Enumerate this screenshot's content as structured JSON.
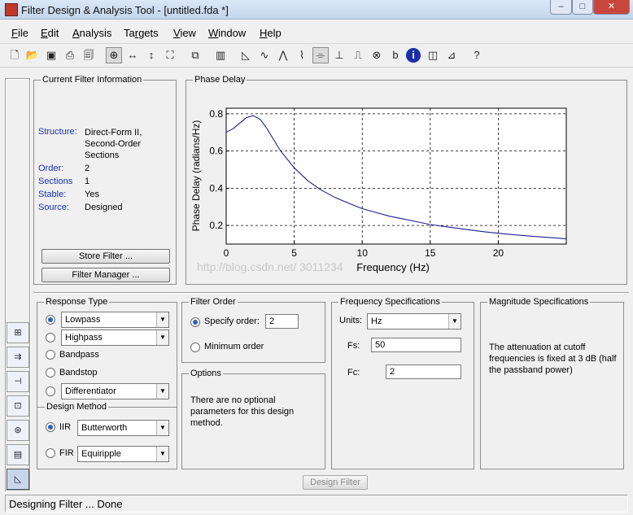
{
  "window": {
    "title": "Filter Design & Analysis Tool - [untitled.fda *]",
    "minimize": "–",
    "maximize": "□",
    "close": "✕"
  },
  "menu": [
    "File",
    "Edit",
    "Analysis",
    "Targets",
    "View",
    "Window",
    "Help"
  ],
  "toolbar_icons": [
    "new-icon",
    "open-icon",
    "save-icon",
    "print-icon",
    "print-preview-icon",
    "zoom-in-icon",
    "zoom-x-icon",
    "zoom-y-icon",
    "full-view-icon",
    "copy-icon",
    "filter-specs-icon",
    "magnitude-response-icon",
    "phase-response-icon",
    "magnitude-phase-icon",
    "group-delay-icon",
    "phase-delay-icon",
    "impulse-response-icon",
    "step-response-icon",
    "pole-zero-icon",
    "filter-coefficients-icon",
    "filter-information-icon",
    "magnitude-estimate-icon",
    "round-off-noise-icon",
    "whats-this-icon"
  ],
  "current_filter": {
    "legend": "Current Filter Information",
    "rows": [
      {
        "key": "Structure:",
        "val": "Direct-Form II, Second-Order Sections"
      },
      {
        "key": "Order:",
        "val": "2"
      },
      {
        "key": "Sections",
        "val": "1"
      },
      {
        "key": "Stable:",
        "val": "Yes"
      },
      {
        "key": "Source:",
        "val": "Designed"
      }
    ],
    "store_button": "Store Filter ...",
    "manager_button": "Filter Manager ..."
  },
  "plot": {
    "legend": "Phase Delay",
    "watermark": "http://blog.csdn.net/   3011234"
  },
  "chart_data": {
    "type": "line",
    "title": "",
    "xlabel": "Frequency (Hz)",
    "ylabel": "Phase Delay (radians/Hz)",
    "xlim": [
      0,
      25
    ],
    "ylim": [
      0.1,
      0.83
    ],
    "xticks": [
      0,
      5,
      10,
      15,
      20
    ],
    "yticks": [
      0.2,
      0.4,
      0.6,
      0.8
    ],
    "grid": true,
    "series": [
      {
        "color": "#1f1f8f",
        "x": [
          0,
          0.5,
          1,
          1.5,
          2,
          2.5,
          3,
          3.5,
          4,
          5,
          6,
          7,
          8,
          9,
          10,
          11,
          12,
          13,
          14,
          15,
          16,
          17,
          18,
          19,
          20,
          21,
          22,
          23,
          24,
          25
        ],
        "y": [
          0.7,
          0.72,
          0.75,
          0.78,
          0.79,
          0.77,
          0.72,
          0.66,
          0.6,
          0.51,
          0.44,
          0.39,
          0.35,
          0.32,
          0.29,
          0.27,
          0.25,
          0.235,
          0.22,
          0.205,
          0.195,
          0.185,
          0.175,
          0.166,
          0.158,
          0.151,
          0.145,
          0.139,
          0.134,
          0.128
        ]
      }
    ]
  },
  "response_type": {
    "legend": "Response Type",
    "lowpass": "Lowpass",
    "highpass": "Highpass",
    "bandpass": "Bandpass",
    "bandstop": "Bandstop",
    "differentiator": "Differentiator"
  },
  "design_method": {
    "legend": "Design Method",
    "iir": "IIR",
    "iir_value": "Butterworth",
    "fir": "FIR",
    "fir_value": "Equiripple"
  },
  "filter_order": {
    "legend": "Filter Order",
    "specify": "Specify order:",
    "order_value": "2",
    "minimum": "Minimum order"
  },
  "options": {
    "legend": "Options",
    "text": "There are no optional parameters for this design method."
  },
  "freq_specs": {
    "legend": "Frequency Specifications",
    "units_label": "Units:",
    "units_value": "Hz",
    "fs_label": "Fs:",
    "fs_value": "50",
    "fc_label": "Fc:",
    "fc_value": "2"
  },
  "mag_specs": {
    "legend": "Magnitude Specifications",
    "text": "The attenuation at cutoff frequencies is fixed at 3 dB (half the passband power)"
  },
  "design_button": "Design Filter",
  "status": "Designing Filter ... Done"
}
